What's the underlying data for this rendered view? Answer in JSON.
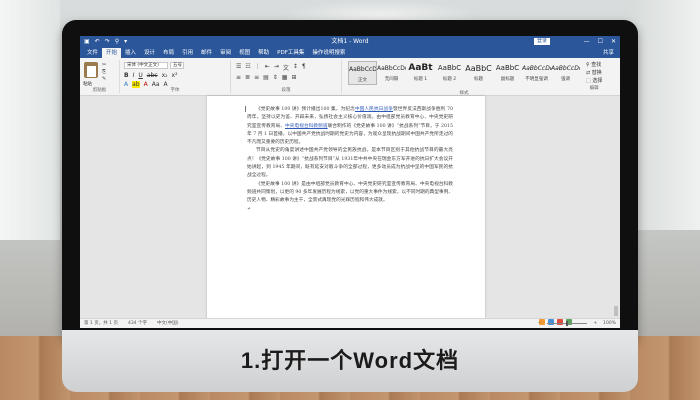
{
  "caption": "1.打开一个Word文档",
  "titlebar": {
    "doc_title": "文档1 - Word",
    "login_label": "登录",
    "quick_access": [
      "▣",
      "↶",
      "↷",
      "⚲",
      "▾"
    ],
    "window_buttons": [
      "—",
      "☐",
      "✕"
    ]
  },
  "ribbon_tabs": [
    "文件",
    "开始",
    "插入",
    "设计",
    "布局",
    "引用",
    "邮件",
    "审阅",
    "视图",
    "帮助",
    "PDF工具集",
    "操作说明搜索"
  ],
  "active_tab": "开始",
  "share_label": "共享",
  "clipboard": {
    "paste_label": "粘贴",
    "group_label": "剪贴板",
    "small_icons": [
      "✂",
      "⎘",
      "✎"
    ]
  },
  "font": {
    "font_name": "宋体 (中文正文)",
    "font_size": "五号",
    "format_buttons": [
      "B",
      "I",
      "U",
      "abc",
      "x₂",
      "x²"
    ],
    "row3": [
      "A",
      "ab",
      "A",
      "Aa",
      "A"
    ],
    "group_label": "字体"
  },
  "paragraph": {
    "row1": [
      "☰",
      "☷",
      "⋮",
      "⇤",
      "⇥",
      "文",
      "↕",
      "¶"
    ],
    "row2": [
      "≡",
      "≣",
      "≡",
      "▤",
      "⇕",
      "▦",
      "⊞"
    ],
    "group_label": "段落"
  },
  "styles": {
    "items": [
      {
        "sample": "AaBbCcDd",
        "name": "正文"
      },
      {
        "sample": "AaBbCcDd",
        "name": "无间隔"
      },
      {
        "sample": "AaBt",
        "name": "标题 1"
      },
      {
        "sample": "AaBbC",
        "name": "标题 2"
      },
      {
        "sample": "AaBbC",
        "name": "标题"
      },
      {
        "sample": "AaBbC",
        "name": "副标题"
      },
      {
        "sample": "AaBbCcDd",
        "name": "不明显强调"
      },
      {
        "sample": "AaBbCcDd",
        "name": "强调"
      }
    ],
    "group_label": "样式"
  },
  "editing": {
    "find_label": "查找",
    "replace_label": "替换",
    "select_label": "选择",
    "group_label": "编辑"
  },
  "document": {
    "p1_a": "《党史故事 100 讲》预计播出100 集，为纪念",
    "p1_link1": "中国人民抗日战争",
    "p1_b": "暨世界反法西斯战争胜利 70 周年，坚持以史为鉴、开辟未来，弘扬社会主义核心价值观，由中组部党员教育中心、中央党史研究室宣传教育局、",
    "p1_link2": "中央电视台科教频道",
    "p1_c": "联合制作的《党史故事 100 讲》“抗战系列”节目，于 2015 年 7 月 1 日首播，以中国共产党抗战时期的党史为内容，为观众呈现抗战期间中国共产党所走过的不凡而又重要的历史历程。",
    "p2": "节目从党史的角度讲述中国共产党领导的全民族抗战，是本节目区别于其他抗战节目的最大亮点！《党史故事 100 讲》“抗战系列节目”从 1931年中共中央在瑞金东方军开进的抗日扩大会议开始讲起，到 1945 年期间，既有延安对敌斗争的全部过程，更多动员成为抗战中坚的中国军民的抗战全过程。",
    "p3": "《党史故事 100 讲》是由中组部党员教育中心、中央党史研究室宣传教育局、中央电视台科教频道共同策划，以更的 90 多年发展历程为线索，以党的重大事件为线索，以不同时期的典型事例、历史人物、精彩故事为主干，全景式再现党的光辉历程和伟大成就。",
    "end_mark": "↵"
  },
  "statusbar": {
    "page": "第 1 页，共 1 页",
    "words": "434 个字",
    "lang": "中文(中国)",
    "zoom": "100%"
  }
}
